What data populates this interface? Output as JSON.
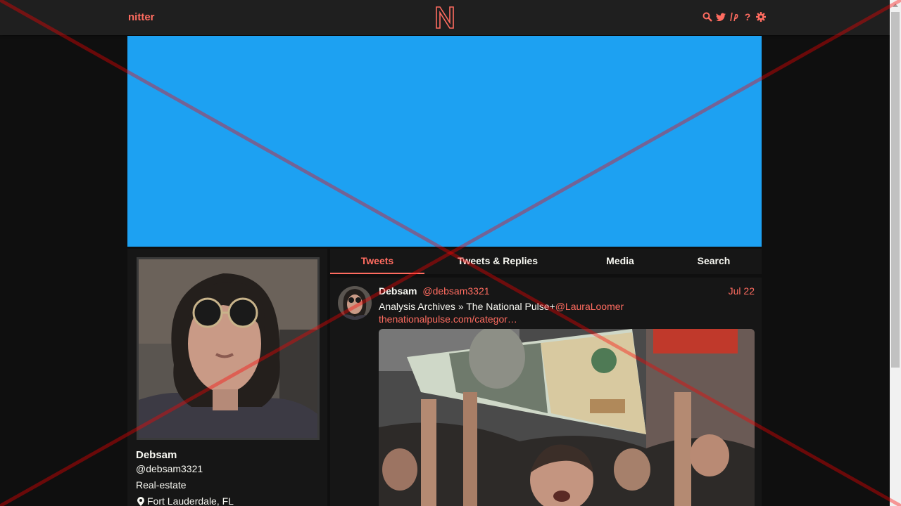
{
  "navbar": {
    "brand": "nitter",
    "icons": [
      "search-icon",
      "bird-icon",
      "lp-icon",
      "help-icon",
      "gear-icon"
    ]
  },
  "profile": {
    "fullname": "Debsam",
    "username": "@debsam3321",
    "bio": "Real-estate",
    "location": "Fort Lauderdale, FL"
  },
  "tabs": [
    {
      "label": "Tweets",
      "active": true
    },
    {
      "label": "Tweets & Replies",
      "active": false
    },
    {
      "label": "Media",
      "active": false
    },
    {
      "label": "Search",
      "active": false
    }
  ],
  "tweet": {
    "fullname": "Debsam",
    "username": "@debsam3321",
    "date": "Jul 22",
    "text": "Analysis Archives » The National Pulse+",
    "mention": "@LauraLoomer",
    "link": "thenationalpulse.com/categor…"
  },
  "colors": {
    "accent": "#ff6c60",
    "banner": "#1da1f2",
    "background": "#0f0f0f",
    "panel": "#161616"
  }
}
